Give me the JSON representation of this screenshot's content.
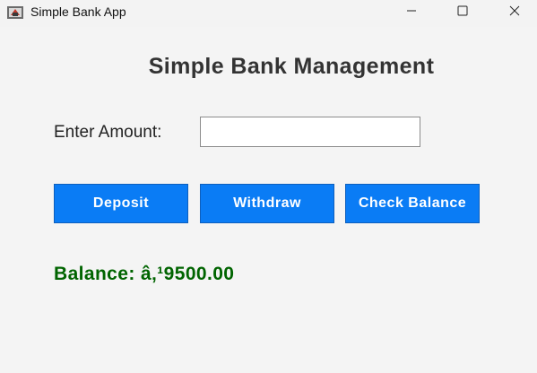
{
  "window": {
    "title": "Simple Bank App",
    "icon": "java-cup-icon"
  },
  "controls": {
    "minimize_icon": "minimize-icon",
    "maximize_icon": "maximize-icon",
    "close_icon": "close-icon"
  },
  "main": {
    "heading": "Simple Bank Management",
    "amount_label": "Enter Amount:",
    "amount_value": "",
    "amount_placeholder": "",
    "buttons": {
      "deposit": "Deposit",
      "withdraw": "Withdraw",
      "check_balance": "Check Balance"
    },
    "balance_text": "Balance: â‚¹9500.00"
  },
  "colors": {
    "button_bg": "#0a7cf5",
    "button_text": "#ffffff",
    "balance_text": "#006400",
    "heading_text": "#333333"
  }
}
